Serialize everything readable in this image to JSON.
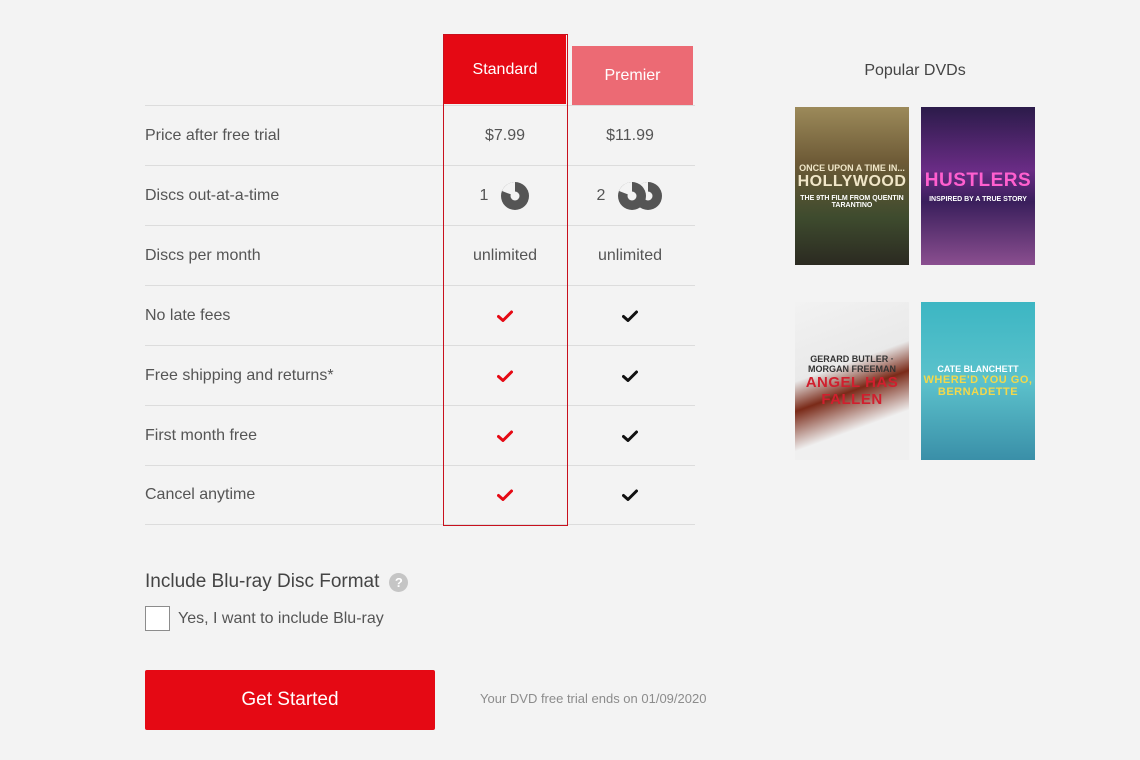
{
  "plans": {
    "columns": [
      {
        "name": "Standard",
        "selected": true
      },
      {
        "name": "Premier",
        "selected": false
      }
    ],
    "rows": [
      {
        "label": "Price after free trial",
        "standard": "$7.99",
        "premier": "$11.99",
        "type": "text"
      },
      {
        "label": "Discs out-at-a-time",
        "standard": "1",
        "premier": "2",
        "type": "discs"
      },
      {
        "label": "Discs per month",
        "standard": "unlimited",
        "premier": "unlimited",
        "type": "text"
      },
      {
        "label": "No late fees",
        "standard": true,
        "premier": true,
        "type": "check"
      },
      {
        "label": "Free shipping and returns*",
        "standard": true,
        "premier": true,
        "type": "check"
      },
      {
        "label": "First month free",
        "standard": true,
        "premier": true,
        "type": "check"
      },
      {
        "label": "Cancel anytime",
        "standard": true,
        "premier": true,
        "type": "check"
      }
    ]
  },
  "popular": {
    "title": "Popular DVDs",
    "posters": [
      {
        "title": "Once Upon a Time in... Hollywood",
        "top": "ONCE UPON A TIME IN...",
        "big": "HOLLYWOOD",
        "tagline": "THE 9TH FILM FROM QUENTIN TARANTINO"
      },
      {
        "title": "Hustlers",
        "big": "HUSTLERS",
        "tagline": "INSPIRED BY A TRUE STORY"
      },
      {
        "title": "Angel Has Fallen",
        "top": "GERARD BUTLER · MORGAN FREEMAN",
        "big": "ANGEL HAS FALLEN"
      },
      {
        "title": "Where'd You Go, Bernadette",
        "top": "CATE BLANCHETT",
        "big": "WHERE'D YOU GO, BERNADETTE"
      }
    ]
  },
  "bluray": {
    "title": "Include Blu-ray Disc Format",
    "help_icon": "?",
    "option_label": "Yes, I want to include Blu-ray",
    "checked": false
  },
  "cta": {
    "button_label": "Get Started",
    "trial_note": "Your DVD free trial ends on 01/09/2020"
  },
  "colors": {
    "accent": "#e50914",
    "premier": "#ec6a74",
    "check_standard": "#e50914",
    "check_premier": "#111111",
    "disc": "#555555"
  }
}
